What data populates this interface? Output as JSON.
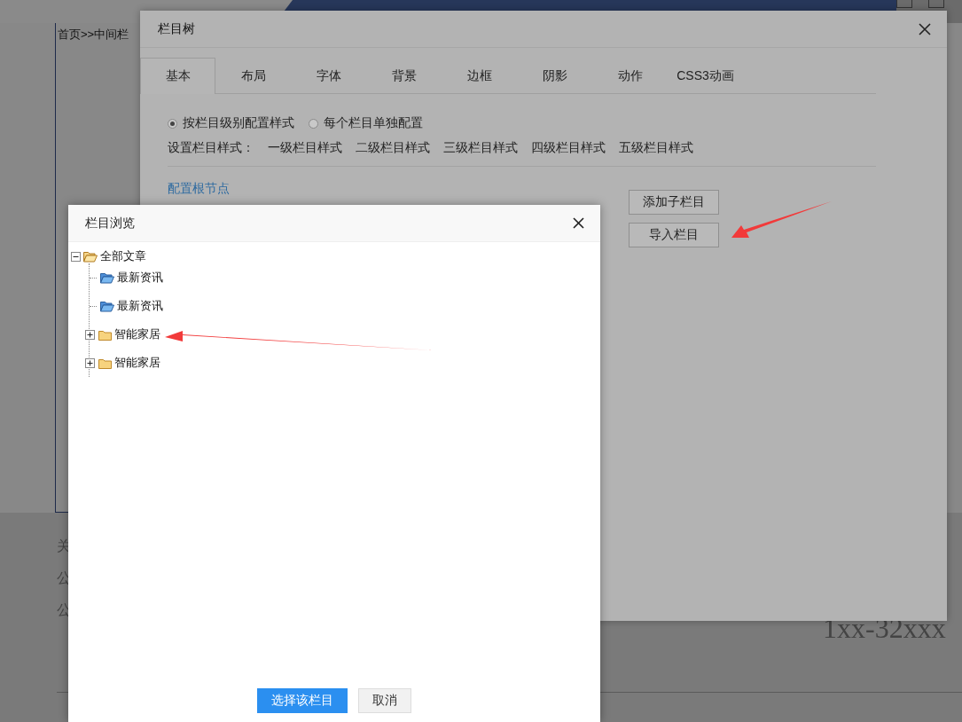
{
  "background_page": {
    "breadcrumb": "首页>>中间栏",
    "footer_lines": [
      "关",
      "公",
      "公"
    ],
    "phone": "1xx-32xxx"
  },
  "column_tree_dialog": {
    "title": "栏目树",
    "tabs": [
      {
        "label": "基本",
        "selected": true
      },
      {
        "label": "布局",
        "selected": false
      },
      {
        "label": "字体",
        "selected": false
      },
      {
        "label": "背景",
        "selected": false
      },
      {
        "label": "边框",
        "selected": false
      },
      {
        "label": "阴影",
        "selected": false
      },
      {
        "label": "动作",
        "selected": false
      },
      {
        "label": "CSS3动画",
        "selected": false
      }
    ],
    "radios": [
      {
        "label": "按栏目级别配置样式",
        "selected": true
      },
      {
        "label": "每个栏目单独配置",
        "selected": false
      }
    ],
    "style_label": "设置栏目样式：",
    "level_styles": [
      "一级栏目样式",
      "二级栏目样式",
      "三级栏目样式",
      "四级栏目样式",
      "五级栏目样式"
    ],
    "root_link": "配置根节点",
    "buttons": [
      "添加子栏目",
      "导入栏目"
    ]
  },
  "browse_dialog": {
    "title": "栏目浏览",
    "tree": [
      {
        "label": "全部文章",
        "kind": "folder",
        "expanded": true,
        "children": [
          {
            "label": "最新资讯",
            "kind": "leaf"
          },
          {
            "label": "最新资讯",
            "kind": "leaf"
          },
          {
            "label": "智能家居",
            "kind": "folder",
            "expanded": false
          },
          {
            "label": "智能家居",
            "kind": "folder",
            "expanded": false
          }
        ]
      }
    ],
    "confirm_button": "选择该栏目",
    "cancel_button": "取消"
  }
}
